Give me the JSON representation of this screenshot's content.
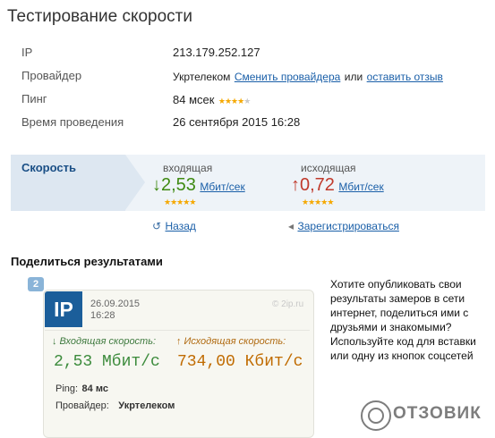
{
  "page_title": "Тестирование скорости",
  "info": {
    "ip_label": "IP",
    "ip_value": "213.179.252.127",
    "provider_label": "Провайдер",
    "provider_value": "Укртелеком",
    "change_provider_link": "Сменить провайдера",
    "or_text": "или",
    "leave_review_link": "оставить отзыв",
    "ping_label": "Пинг",
    "ping_value": "84 мсек",
    "ping_rating": 4,
    "time_label": "Время проведения",
    "time_value": "26 сентября 2015 16:28"
  },
  "speed": {
    "label": "Скорость",
    "incoming_label": "входящая",
    "incoming_arrow": "↓",
    "incoming_value": "2,53",
    "incoming_unit": "Мбит/сек",
    "incoming_rating": 5,
    "outgoing_label": "исходящая",
    "outgoing_arrow": "↑",
    "outgoing_value": "0,72",
    "outgoing_unit": "Мбит/сек",
    "outgoing_rating": 5
  },
  "nav": {
    "back_icon": "↺",
    "back_label": "Назад",
    "register_icon": "◂",
    "register_label": "Зарегистрироваться"
  },
  "share": {
    "heading": "Поделиться результатами",
    "card": {
      "badge": "2",
      "logo": "IP",
      "date": "26.09.2015",
      "time": "16:28",
      "site": "© 2ip.ru",
      "incoming_label": "↓ Входящая скорость:",
      "incoming_value": "2,53 Мбит/с",
      "outgoing_label": "↑ Исходящая скорость:",
      "outgoing_value": "734,00 Кбит/с",
      "ping_label": "Ping:",
      "ping_value": "84 мс",
      "provider_label": "Провайдер:",
      "provider_value": "Укртелеком"
    },
    "text_lines": [
      "Хотите опубликовать свои",
      "результаты замеров в сети",
      "интернет, поделиться ими с",
      "друзьями и знакомыми?",
      "Используйте код для вставки",
      "или одну из кнопок соцсетей"
    ]
  },
  "watermark": "ОТЗОВИК",
  "colors": {
    "accent_blue": "#1a5fa8",
    "incoming_green": "#3f8a12",
    "outgoing_red": "#c0392b",
    "stars": "#f5a800"
  }
}
